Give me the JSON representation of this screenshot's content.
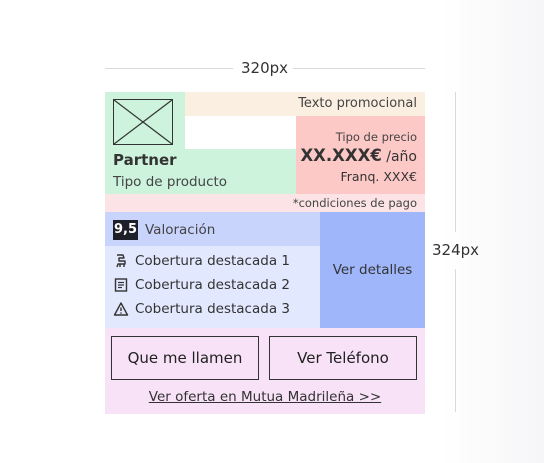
{
  "dimensions": {
    "width_label": "320px",
    "height_label": "324px"
  },
  "card": {
    "promo_text": "Texto promocional",
    "partner": "Partner",
    "product_type": "Tipo de producto",
    "price": {
      "type_label": "Tipo de precio",
      "amount": "XX.XXX€",
      "period": " /año",
      "franchise": "Franq. XXX€"
    },
    "conditions": "*condiciones de pago",
    "rating": {
      "score": "9,5",
      "label": "Valoración"
    },
    "coverages": [
      {
        "icon": "car-seat-icon",
        "label": "Cobertura destacada 1"
      },
      {
        "icon": "document-icon",
        "label": "Cobertura destacada 2"
      },
      {
        "icon": "warning-icon",
        "label": "Cobertura destacada 3"
      }
    ],
    "details_label": "Ver detalles",
    "buttons": {
      "call": "Que me llamen",
      "phone": "Ver Teléfono"
    },
    "offer_link": "Ver oferta en Mutua Madrileña >>"
  },
  "colors": {
    "promo_bg": "#fbefe2",
    "partner_bg": "#cdf3dd",
    "price_bg": "#fdc9c7",
    "conditions_bg": "#fbe3e6",
    "rating_bg": "#c8d4fc",
    "coverage_bg": "#e2e8fd",
    "details_bg": "#9fb6fb",
    "cta_bg": "#f8e2f7",
    "score_bg": "#1f1f2a"
  }
}
